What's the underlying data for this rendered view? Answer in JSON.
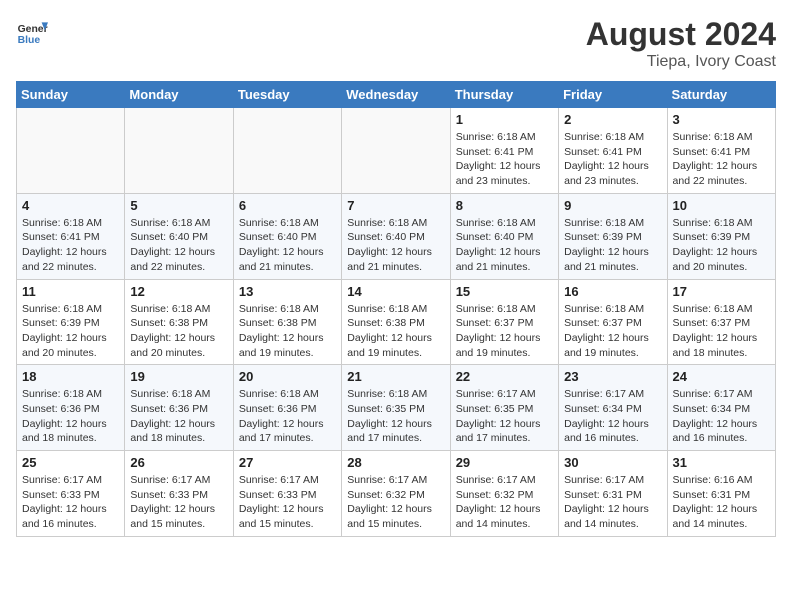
{
  "header": {
    "logo_line1": "General",
    "logo_line2": "Blue",
    "month_year": "August 2024",
    "location": "Tiepa, Ivory Coast"
  },
  "days_of_week": [
    "Sunday",
    "Monday",
    "Tuesday",
    "Wednesday",
    "Thursday",
    "Friday",
    "Saturday"
  ],
  "weeks": [
    [
      {
        "day": "",
        "empty": true
      },
      {
        "day": "",
        "empty": true
      },
      {
        "day": "",
        "empty": true
      },
      {
        "day": "",
        "empty": true
      },
      {
        "day": "1",
        "sunrise": "6:18 AM",
        "sunset": "6:41 PM",
        "daylight": "12 hours and 23 minutes."
      },
      {
        "day": "2",
        "sunrise": "6:18 AM",
        "sunset": "6:41 PM",
        "daylight": "12 hours and 23 minutes."
      },
      {
        "day": "3",
        "sunrise": "6:18 AM",
        "sunset": "6:41 PM",
        "daylight": "12 hours and 22 minutes."
      }
    ],
    [
      {
        "day": "4",
        "sunrise": "6:18 AM",
        "sunset": "6:41 PM",
        "daylight": "12 hours and 22 minutes."
      },
      {
        "day": "5",
        "sunrise": "6:18 AM",
        "sunset": "6:40 PM",
        "daylight": "12 hours and 22 minutes."
      },
      {
        "day": "6",
        "sunrise": "6:18 AM",
        "sunset": "6:40 PM",
        "daylight": "12 hours and 21 minutes."
      },
      {
        "day": "7",
        "sunrise": "6:18 AM",
        "sunset": "6:40 PM",
        "daylight": "12 hours and 21 minutes."
      },
      {
        "day": "8",
        "sunrise": "6:18 AM",
        "sunset": "6:40 PM",
        "daylight": "12 hours and 21 minutes."
      },
      {
        "day": "9",
        "sunrise": "6:18 AM",
        "sunset": "6:39 PM",
        "daylight": "12 hours and 21 minutes."
      },
      {
        "day": "10",
        "sunrise": "6:18 AM",
        "sunset": "6:39 PM",
        "daylight": "12 hours and 20 minutes."
      }
    ],
    [
      {
        "day": "11",
        "sunrise": "6:18 AM",
        "sunset": "6:39 PM",
        "daylight": "12 hours and 20 minutes."
      },
      {
        "day": "12",
        "sunrise": "6:18 AM",
        "sunset": "6:38 PM",
        "daylight": "12 hours and 20 minutes."
      },
      {
        "day": "13",
        "sunrise": "6:18 AM",
        "sunset": "6:38 PM",
        "daylight": "12 hours and 19 minutes."
      },
      {
        "day": "14",
        "sunrise": "6:18 AM",
        "sunset": "6:38 PM",
        "daylight": "12 hours and 19 minutes."
      },
      {
        "day": "15",
        "sunrise": "6:18 AM",
        "sunset": "6:37 PM",
        "daylight": "12 hours and 19 minutes."
      },
      {
        "day": "16",
        "sunrise": "6:18 AM",
        "sunset": "6:37 PM",
        "daylight": "12 hours and 19 minutes."
      },
      {
        "day": "17",
        "sunrise": "6:18 AM",
        "sunset": "6:37 PM",
        "daylight": "12 hours and 18 minutes."
      }
    ],
    [
      {
        "day": "18",
        "sunrise": "6:18 AM",
        "sunset": "6:36 PM",
        "daylight": "12 hours and 18 minutes."
      },
      {
        "day": "19",
        "sunrise": "6:18 AM",
        "sunset": "6:36 PM",
        "daylight": "12 hours and 18 minutes."
      },
      {
        "day": "20",
        "sunrise": "6:18 AM",
        "sunset": "6:36 PM",
        "daylight": "12 hours and 17 minutes."
      },
      {
        "day": "21",
        "sunrise": "6:18 AM",
        "sunset": "6:35 PM",
        "daylight": "12 hours and 17 minutes."
      },
      {
        "day": "22",
        "sunrise": "6:17 AM",
        "sunset": "6:35 PM",
        "daylight": "12 hours and 17 minutes."
      },
      {
        "day": "23",
        "sunrise": "6:17 AM",
        "sunset": "6:34 PM",
        "daylight": "12 hours and 16 minutes."
      },
      {
        "day": "24",
        "sunrise": "6:17 AM",
        "sunset": "6:34 PM",
        "daylight": "12 hours and 16 minutes."
      }
    ],
    [
      {
        "day": "25",
        "sunrise": "6:17 AM",
        "sunset": "6:33 PM",
        "daylight": "12 hours and 16 minutes."
      },
      {
        "day": "26",
        "sunrise": "6:17 AM",
        "sunset": "6:33 PM",
        "daylight": "12 hours and 15 minutes."
      },
      {
        "day": "27",
        "sunrise": "6:17 AM",
        "sunset": "6:33 PM",
        "daylight": "12 hours and 15 minutes."
      },
      {
        "day": "28",
        "sunrise": "6:17 AM",
        "sunset": "6:32 PM",
        "daylight": "12 hours and 15 minutes."
      },
      {
        "day": "29",
        "sunrise": "6:17 AM",
        "sunset": "6:32 PM",
        "daylight": "12 hours and 14 minutes."
      },
      {
        "day": "30",
        "sunrise": "6:17 AM",
        "sunset": "6:31 PM",
        "daylight": "12 hours and 14 minutes."
      },
      {
        "day": "31",
        "sunrise": "6:16 AM",
        "sunset": "6:31 PM",
        "daylight": "12 hours and 14 minutes."
      }
    ]
  ],
  "labels": {
    "sunrise": "Sunrise:",
    "sunset": "Sunset:",
    "daylight": "Daylight:"
  }
}
